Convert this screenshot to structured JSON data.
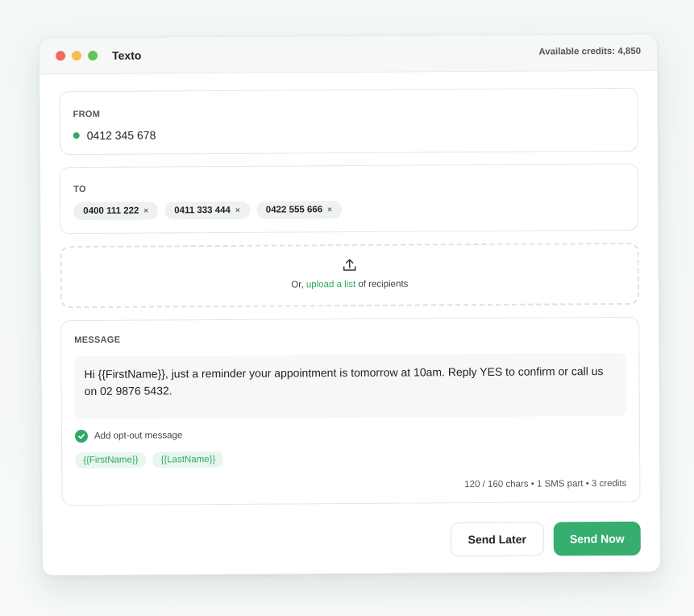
{
  "window": {
    "title": "Texto",
    "credits": "Available credits: 4,850",
    "traffic_lights": [
      "#ee6a5f",
      "#f5be4f",
      "#62c655"
    ]
  },
  "from": {
    "label": "FROM",
    "number": "0412 345 678",
    "status_color": "#2fa86a"
  },
  "to": {
    "label": "TO",
    "recipients": [
      "0400 111 222",
      "0411 333 444",
      "0422 555 666"
    ],
    "remove_glyph": "×"
  },
  "upload": {
    "prefix": "Or, ",
    "link": "upload a list",
    "suffix": " of recipients",
    "icon": "upload-icon"
  },
  "message": {
    "label": "MESSAGE",
    "body": "Hi {{FirstName}}, just a reminder your appointment is tomorrow at 10am. Reply YES to confirm or call us on 02 9876 5432.",
    "optout_label": "Add opt-out message",
    "optout_checked": true,
    "tags": [
      "{{FirstName}}",
      "{{LastName}}"
    ],
    "count": "120 / 160 chars • 1 SMS part • 3 credits"
  },
  "actions": {
    "send_later": "Send Later",
    "send_now": "Send Now"
  },
  "colors": {
    "accent": "#37ad6f"
  }
}
